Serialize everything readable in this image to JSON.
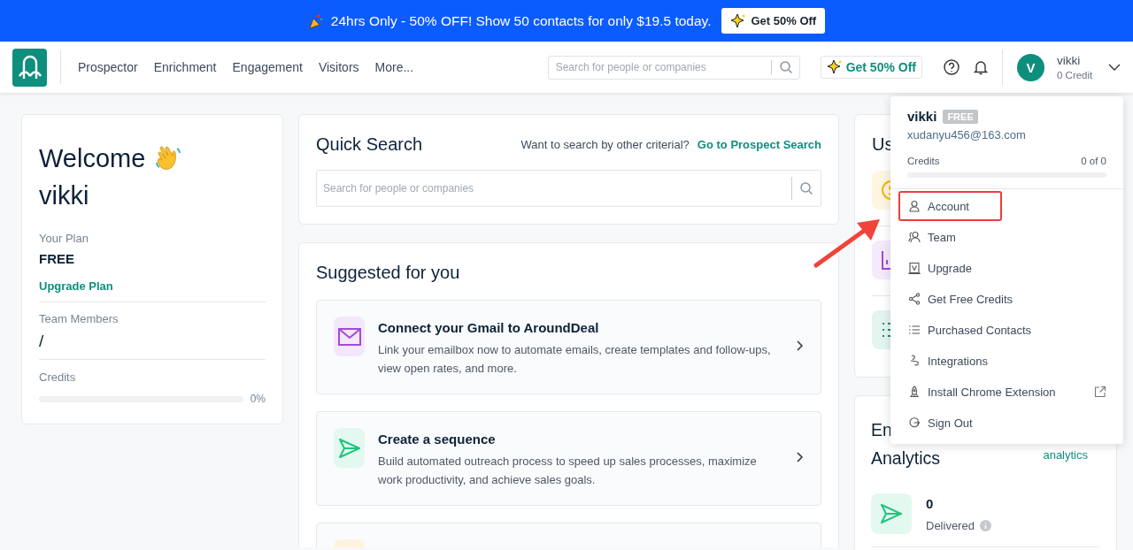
{
  "banner": {
    "text": "24hrs Only - 50% OFF! Show 50 contacts for only $19.5 today.",
    "button": "Get 50% Off"
  },
  "header": {
    "nav": [
      {
        "label": "Prospector"
      },
      {
        "label": "Enrichment"
      },
      {
        "label": "Engagement"
      },
      {
        "label": "Visitors"
      },
      {
        "label": "More..."
      }
    ],
    "search": {
      "placeholder": "Search for people or companies"
    },
    "promo": "Get 50% Off",
    "user": {
      "initial": "V",
      "name": "vikki",
      "credit": "0 Credit"
    }
  },
  "welcome": {
    "title": "Welcome",
    "name": "vikki",
    "plan_label": "Your Plan",
    "plan": "FREE",
    "upgrade": "Upgrade Plan",
    "team_label": "Team Members",
    "team": "/",
    "credits_label": "Credits",
    "level": 0,
    "credits_pct": "0%"
  },
  "quick_search": {
    "title": "Quick Search",
    "hint": "Want to search by other criterial?",
    "link": "Go to Prospect Search",
    "placeholder": "Search for people or companies"
  },
  "suggested": {
    "title": "Suggested for you",
    "items": [
      {
        "kind": "mail",
        "title": "Connect your Gmail to AroundDeal",
        "desc": "Link your emailbox now to automate emails, create templates and follow-ups, view open rates, and more."
      },
      {
        "kind": "send",
        "title": "Create a sequence",
        "desc": "Build automated outreach process to speed up sales processes, maximize work productivity, and achieve sales goals."
      },
      {
        "kind": "clipped"
      }
    ]
  },
  "usage": {
    "title": "Us",
    "tiles": [
      {
        "kind": "coin"
      },
      {
        "kind": "chart"
      },
      {
        "kind": "list"
      }
    ]
  },
  "email_analytics": {
    "title": "En",
    "subtitle": "Analytics",
    "link": "analytics",
    "stats": [
      {
        "kind": "send",
        "value": "0",
        "label": "Delivered"
      }
    ]
  },
  "menu": {
    "name": "vikki",
    "badge": "FREE",
    "email": "xudanyu456@163.com",
    "credits_label": "Credits",
    "credits_value": "0 of 0",
    "level": 0,
    "items": [
      {
        "kind": "user",
        "label": "Account",
        "highlighted": true,
        "external": false
      },
      {
        "kind": "team",
        "label": "Team",
        "highlighted": false,
        "external": false
      },
      {
        "kind": "upgrade",
        "label": "Upgrade",
        "highlighted": false,
        "external": false
      },
      {
        "kind": "share",
        "label": "Get Free Credits",
        "highlighted": false,
        "external": false
      },
      {
        "kind": "list",
        "label": "Purchased Contacts",
        "highlighted": false,
        "external": false
      },
      {
        "kind": "link",
        "label": "Integrations",
        "highlighted": false,
        "external": false
      },
      {
        "kind": "rocket",
        "label": "Install Chrome Extension",
        "highlighted": false,
        "external": true
      },
      {
        "kind": "signout",
        "label": "Sign Out",
        "highlighted": false,
        "external": false
      }
    ]
  },
  "annotation_arrow": true
}
